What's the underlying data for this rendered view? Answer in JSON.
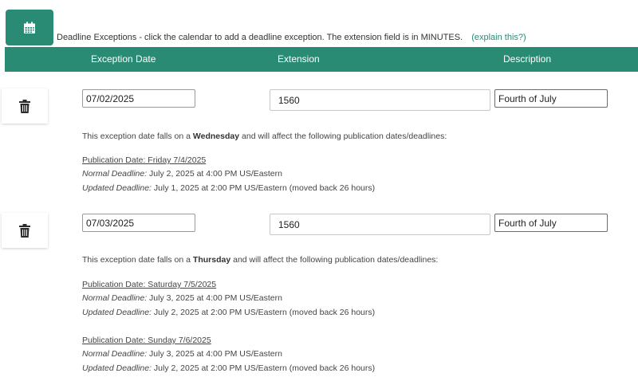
{
  "intro": {
    "text": "Deadline Exceptions - click the calendar to add a deadline exception. The extension field is in MINUTES.",
    "explain_link": "(explain this?)"
  },
  "header": {
    "col_date": "Exception Date",
    "col_extension": "Extension",
    "col_description": "Description"
  },
  "colors": {
    "accent": "#2a8b75",
    "header_text": "#ffffff"
  },
  "icons": {
    "add": "calendar-icon",
    "delete": "trash-icon"
  },
  "labels": {
    "note_prefix": "This exception date falls on a",
    "note_suffix": "and will affect the following publication dates/deadlines:",
    "normal_deadline": "Normal Deadline:",
    "updated_deadline": "Updated Deadline:"
  },
  "exceptions": [
    {
      "date": "07/02/2025",
      "extension": "1560",
      "description": "Fourth of July",
      "weekday": "Wednesday",
      "publications": [
        {
          "title": "Publication Date: Friday 7/4/2025",
          "normal": "July 2, 2025 at 4:00 PM US/Eastern",
          "updated": "July 1, 2025 at 2:00 PM US/Eastern (moved back 26 hours)"
        }
      ]
    },
    {
      "date": "07/03/2025",
      "extension": "1560",
      "description": "Fourth of July",
      "weekday": "Thursday",
      "publications": [
        {
          "title": "Publication Date: Saturday 7/5/2025",
          "normal": "July 3, 2025 at 4:00 PM US/Eastern",
          "updated": "July 2, 2025 at 2:00 PM US/Eastern (moved back 26 hours)"
        },
        {
          "title": "Publication Date: Sunday 7/6/2025",
          "normal": "July 3, 2025 at 4:00 PM US/Eastern",
          "updated": "July 2, 2025 at 2:00 PM US/Eastern (moved back 26 hours)"
        }
      ]
    }
  ]
}
